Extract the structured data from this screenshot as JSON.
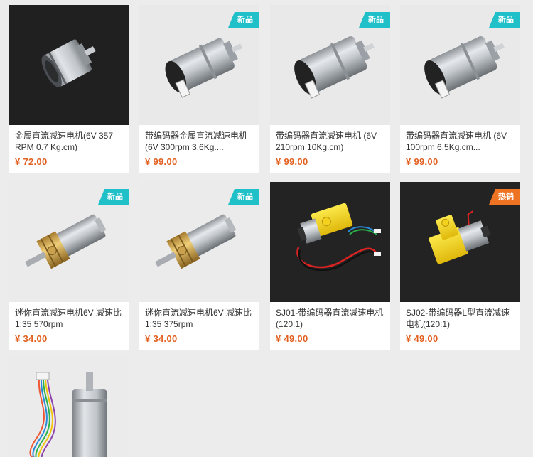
{
  "colors": {
    "page_bg": "#ececec",
    "card_bg": "#ffffff",
    "price": "#e2601f",
    "badge_new": "#20c0c8",
    "badge_hot": "#ee7322"
  },
  "products": [
    {
      "title": "金属直流减速电机(6V 357 RPM 0.7 Kg.cm)",
      "price": "¥ 72.00",
      "badge": "",
      "image": "metal-gear-motor-dark"
    },
    {
      "title": "带编码器金属直流减速电机 (6V 300rpm 3.6Kg....",
      "price": "¥ 99.00",
      "badge": "新品",
      "image": "encoder-gear-motor"
    },
    {
      "title": "带编码器直流减速电机 (6V 210rpm 10Kg.cm)",
      "price": "¥ 99.00",
      "badge": "新品",
      "image": "encoder-gear-motor"
    },
    {
      "title": "带编码器直流减速电机 (6V 100rpm 6.5Kg.cm...",
      "price": "¥ 99.00",
      "badge": "新品",
      "image": "encoder-gear-motor"
    },
    {
      "title": "迷你直流减速电机6V 减速比1:35 570rpm",
      "price": "¥ 34.00",
      "badge": "新品",
      "image": "mini-brass-gear-motor"
    },
    {
      "title": "迷你直流减速电机6V 减速比1:35 375rpm",
      "price": "¥ 34.00",
      "badge": "新品",
      "image": "mini-brass-gear-motor"
    },
    {
      "title": "SJ01-带编码器直流减速电机(120:1)",
      "price": "¥ 49.00",
      "badge": "",
      "image": "yellow-tt-motor-wires"
    },
    {
      "title": "SJ02-带编码器L型直流减速电机(120:1)",
      "price": "¥ 49.00",
      "badge": "热销",
      "image": "yellow-l-motor"
    },
    {
      "title": "",
      "price": "",
      "badge": "",
      "image": "motor-with-rainbow-cable"
    }
  ]
}
